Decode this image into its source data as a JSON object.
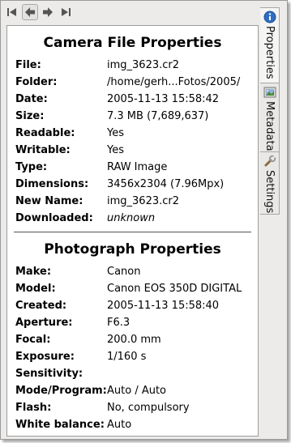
{
  "toolbar": {
    "buttons": [
      {
        "name": "first-icon"
      },
      {
        "name": "back-icon"
      },
      {
        "name": "forward-icon"
      },
      {
        "name": "last-icon"
      }
    ]
  },
  "camera": {
    "title": "Camera File Properties",
    "rows": [
      {
        "label": "File:",
        "value": "img_3623.cr2"
      },
      {
        "label": "Folder:",
        "value": "/home/gerh...Fotos/2005/"
      },
      {
        "label": "Date:",
        "value": "2005-11-13 15:58:42"
      },
      {
        "label": "Size:",
        "value": "7.3 MB (7,689,637)"
      },
      {
        "label": "Readable:",
        "value": "Yes"
      },
      {
        "label": "Writable:",
        "value": "Yes"
      },
      {
        "label": "Type:",
        "value": "RAW Image"
      },
      {
        "label": "Dimensions:",
        "value": "3456x2304 (7.96Mpx)"
      },
      {
        "label": "New Name:",
        "value": "img_3623.cr2"
      },
      {
        "label": "Downloaded:",
        "value": "unknown"
      }
    ]
  },
  "photo": {
    "title": "Photograph Properties",
    "rows": [
      {
        "label": "Make:",
        "value": "Canon"
      },
      {
        "label": "Model:",
        "value": "Canon EOS 350D DIGITAL"
      },
      {
        "label": "Created:",
        "value": "2005-11-13 15:58:40"
      },
      {
        "label": "Aperture:",
        "value": "F6.3"
      },
      {
        "label": "Focal:",
        "value": "200.0 mm"
      },
      {
        "label": "Exposure:",
        "value": "1/160 s"
      },
      {
        "label": "Sensitivity:",
        "value": ""
      },
      {
        "label": "Mode/Program:",
        "value": "Auto / Auto"
      },
      {
        "label": "Flash:",
        "value": "No, compulsory"
      },
      {
        "label": "White balance:",
        "value": "Auto"
      }
    ]
  },
  "tabs": {
    "properties": "Properties",
    "metadata": "Metadata",
    "settings": "Settings"
  }
}
